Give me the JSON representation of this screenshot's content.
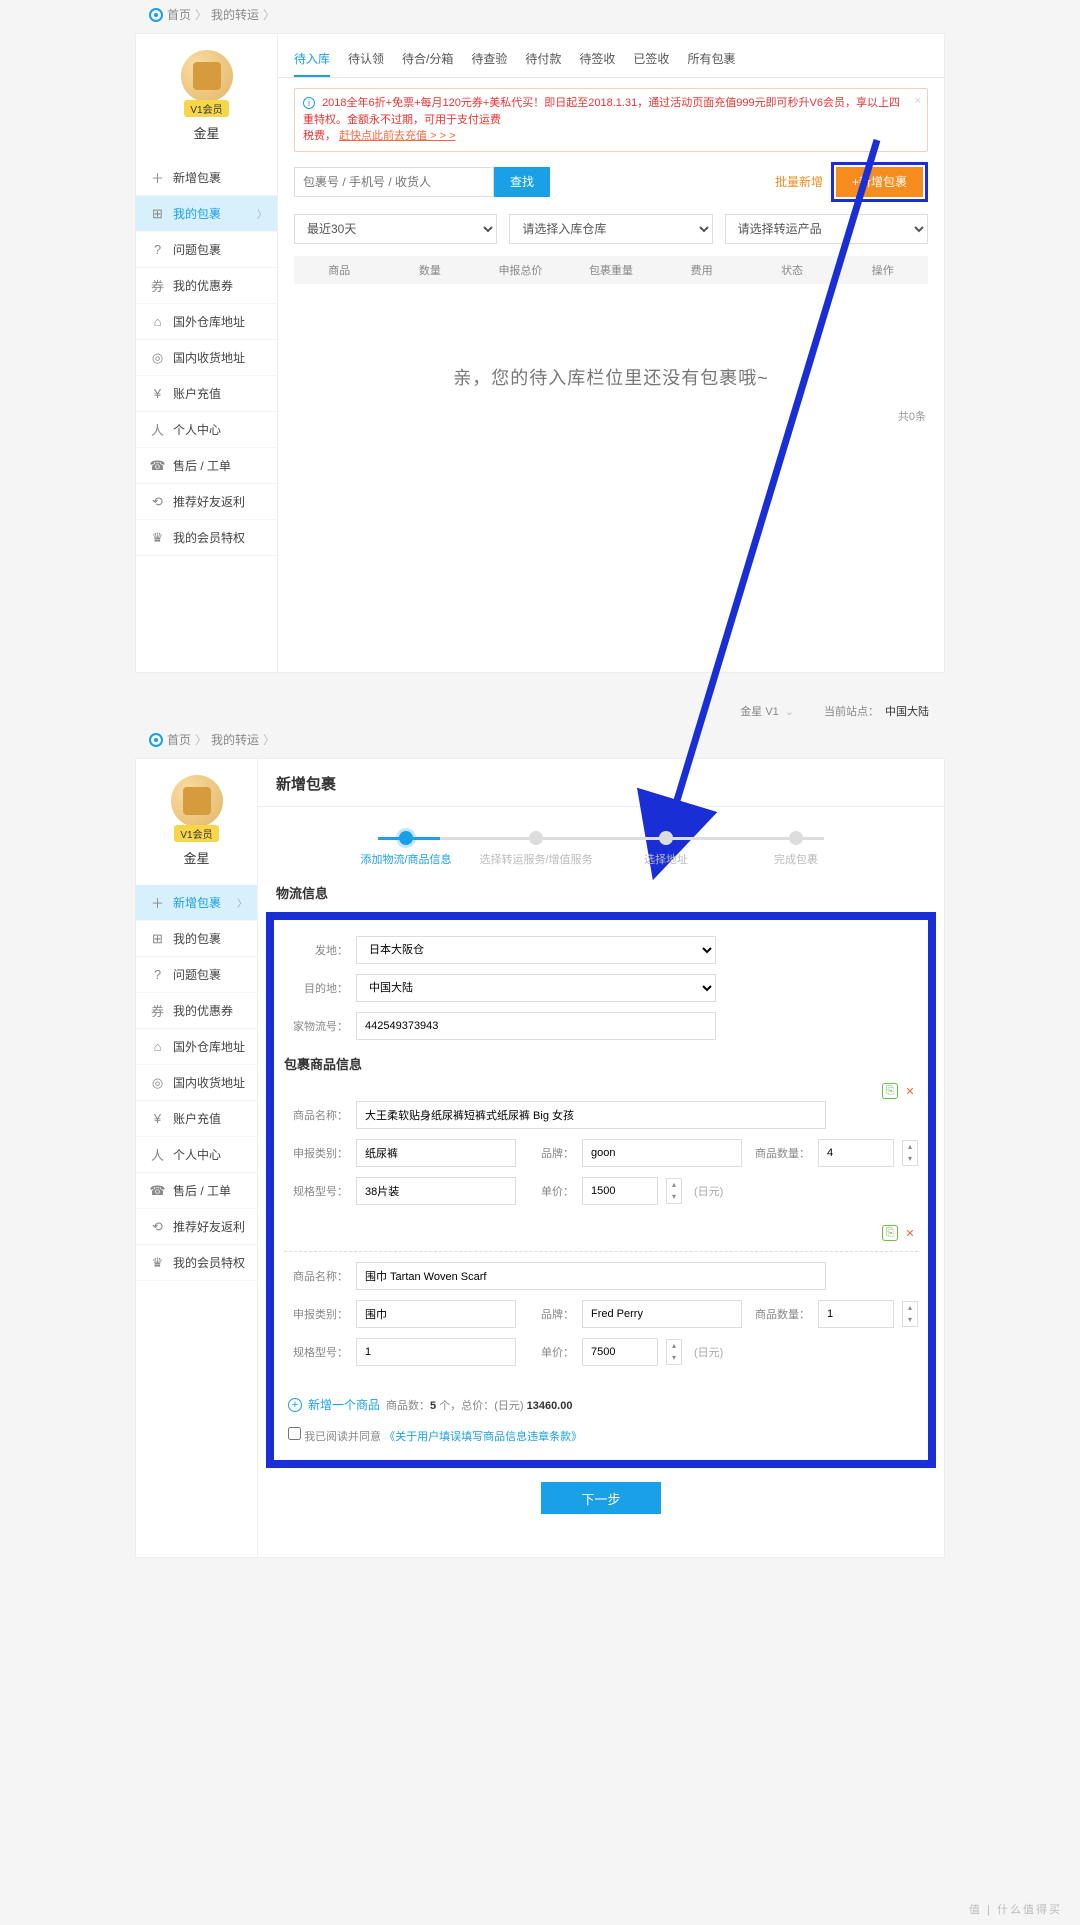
{
  "breadcrumb": {
    "home": "首页",
    "current": "我的转运"
  },
  "user": {
    "badge": "V1会员",
    "name": "金星"
  },
  "sidemenu": [
    {
      "icon": "＋",
      "label": "新增包裹"
    },
    {
      "icon": "⊞",
      "label": "我的包裹"
    },
    {
      "icon": "?",
      "label": "问题包裹"
    },
    {
      "icon": "券",
      "label": "我的优惠券"
    },
    {
      "icon": "⌂",
      "label": "国外仓库地址"
    },
    {
      "icon": "◎",
      "label": "国内收货地址"
    },
    {
      "icon": "¥",
      "label": "账户充值"
    },
    {
      "icon": "人",
      "label": "个人中心"
    },
    {
      "icon": "☎",
      "label": "售后 / 工单"
    },
    {
      "icon": "⟲",
      "label": "推荐好友返利"
    },
    {
      "icon": "♛",
      "label": "我的会员特权"
    }
  ],
  "tabs": [
    "待入库",
    "待认领",
    "待合/分箱",
    "待查验",
    "待付款",
    "待签收",
    "已签收",
    "所有包裹"
  ],
  "alert": {
    "line1a": "2018全年6折+免票+每月120元券+美私代买！即日起至2018.1.31，通过活动页面充值999元即可秒升V6会员，享以上四重特权。金额永不过期，可用于支付运费",
    "line1b": "税费，",
    "link": "赶快点此前去充值 > > >"
  },
  "search": {
    "placeholder": "包裹号 / 手机号 / 收货人",
    "btn": "查找",
    "batch": "批量新增",
    "add": "+新增包裹"
  },
  "filters": {
    "date": "最近30天",
    "wh": "请选择入库仓库",
    "prod": "请选择转运产品"
  },
  "thead": [
    "商品",
    "数量",
    "申报总价",
    "包裹重量",
    "费用",
    "状态",
    "操作"
  ],
  "empty": "亲，您的待入库栏位里还没有包裹哦~",
  "count": "共0条",
  "toprow": {
    "userlv": "金星 V1",
    "sitelabel": "当前站点：",
    "site": "中国大陆"
  },
  "page2": {
    "title": "新增包裹",
    "steps": [
      "添加物流/商品信息",
      "选择转运服务/增值服务",
      "选择地址",
      "完成包裹"
    ],
    "sect_logi": "物流信息",
    "sect_goods": "包裹商品信息",
    "logi": {
      "from_l": "发地：",
      "from_v": "日本大阪仓",
      "to_l": "目的地：",
      "to_v": "中国大陆",
      "trk_l": "家物流号：",
      "trk_v": "442549373943"
    },
    "items": [
      {
        "name_l": "商品名称：",
        "name": "大王柔软贴身纸尿裤短裤式纸尿裤 Big 女孩",
        "cat_l": "申报类别：",
        "cat": "纸尿裤",
        "brand_l": "品牌：",
        "brand": "goon",
        "qty_l": "商品数量：",
        "qty": "4",
        "spec_l": "规格型号：",
        "spec": "38片装",
        "price_l": "单价：",
        "price": "1500",
        "unit": "(日元)"
      },
      {
        "name_l": "商品名称：",
        "name": "围巾 Tartan Woven Scarf",
        "cat_l": "申报类别：",
        "cat": "围巾",
        "brand_l": "品牌：",
        "brand": "Fred Perry",
        "qty_l": "商品数量：",
        "qty": "1",
        "spec_l": "规格型号：",
        "spec": "1",
        "price_l": "单价：",
        "price": "7500",
        "unit": "(日元)"
      }
    ],
    "addone": "新增一个商品",
    "summary_a": "商品数：",
    "summary_b": "5",
    "summary_c": " 个，总价：(日元) ",
    "summary_d": "13460.00",
    "agree_a": "我已阅读并同意",
    "agree_b": "《关于用户填误填写商品信息违章条款》",
    "next": "下一步"
  },
  "watermark": "值 | 什么值得买"
}
